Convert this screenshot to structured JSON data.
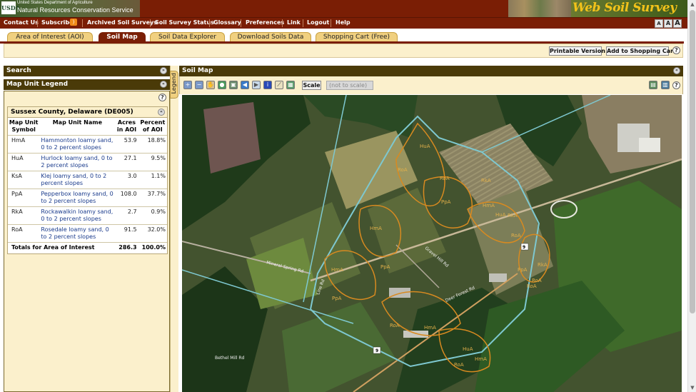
{
  "header": {
    "usda_mark": "USDA",
    "usda_dept": "United States Department of Agriculture",
    "agency": "Natural Resources Conservation Service",
    "app_title": "Web Soil Survey"
  },
  "nav": {
    "items": [
      "Contact Us",
      "Subscribe",
      "Archived Soil Surveys",
      "Soil Survey Status",
      "Glossary",
      "Preferences",
      "Link",
      "Logout",
      "Help"
    ],
    "font_sizes": [
      "A",
      "A",
      "A"
    ]
  },
  "tabs": [
    {
      "label": "Area of Interest (AOI)",
      "active": false
    },
    {
      "label": "Soil Map",
      "active": true
    },
    {
      "label": "Soil Data Explorer",
      "active": false
    },
    {
      "label": "Download Soils Data",
      "active": false
    },
    {
      "label": "Shopping Cart (Free)",
      "active": false
    }
  ],
  "actions": {
    "printable": "Printable Version",
    "add_cart": "Add to Shopping Cart"
  },
  "left": {
    "search_title": "Search",
    "legend_title": "Map Unit Legend",
    "legend_tab": "Legend",
    "county": "Sussex County, Delaware (DE005)",
    "columns": [
      "Map Unit Symbol",
      "Map Unit Name",
      "Acres in AOI",
      "Percent of AOI"
    ],
    "rows": [
      {
        "symbol": "HmA",
        "name": "Hammonton loamy sand, 0 to 2 percent slopes",
        "acres": "53.9",
        "percent": "18.8%"
      },
      {
        "symbol": "HuA",
        "name": "Hurlock loamy sand, 0 to 2 percent slopes",
        "acres": "27.1",
        "percent": "9.5%"
      },
      {
        "symbol": "KsA",
        "name": "Klej loamy sand, 0 to 2 percent slopes",
        "acres": "3.0",
        "percent": "1.1%"
      },
      {
        "symbol": "PpA",
        "name": "Pepperbox loamy sand, 0 to 2 percent slopes",
        "acres": "108.0",
        "percent": "37.7%"
      },
      {
        "symbol": "RkA",
        "name": "Rockawalkin loamy sand, 0 to 2 percent slopes",
        "acres": "2.7",
        "percent": "0.9%"
      },
      {
        "symbol": "RoA",
        "name": "Rosedale loamy sand, 0 to 2 percent slopes",
        "acres": "91.5",
        "percent": "32.0%"
      }
    ],
    "total_label": "Totals for Area of Interest",
    "total_acres": "286.3",
    "total_percent": "100.0%"
  },
  "map": {
    "title": "Soil Map",
    "scale_label": "Scale",
    "scale_value": "(not to scale)",
    "unit_labels": [
      "HuA",
      "RoA",
      "RoA",
      "RkA",
      "PpA",
      "HmA",
      "HmA",
      "HuA",
      "RkA",
      "RoA",
      "PpA",
      "HmA",
      "RoA",
      "PpA",
      "HmA",
      "RoA",
      "PpA",
      "HuA",
      "HmA",
      "RoA",
      "RkA",
      "RoA"
    ],
    "road_labels": [
      "Mineral Spring Rd",
      "Gravel Hill Rd",
      "Line Rd",
      "Bethel Mill Rd",
      "Deer Forest Rd"
    ],
    "route_shields": [
      "9",
      "9"
    ]
  }
}
